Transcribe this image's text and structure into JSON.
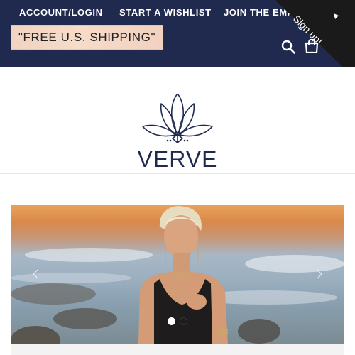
{
  "nav": {
    "items": [
      {
        "label": "ACCOUNT/LOGIN"
      },
      {
        "label": "START A WISHLIST"
      },
      {
        "label": "JOIN THE EMA"
      }
    ]
  },
  "promo": {
    "label": "\"FREE U.S. SHIPPING\""
  },
  "ribbon": {
    "label": "Sign up!"
  },
  "logo": {
    "brand": "VERVE"
  },
  "colors": {
    "header": "#1f2a4e",
    "logo_navy": "#1f2a4e",
    "ribbon": "#1a1a1a"
  },
  "icons": {
    "search": "search-icon",
    "cart": "cart-icon"
  },
  "carousel": {
    "slide_count": 2,
    "active_index": 0
  }
}
